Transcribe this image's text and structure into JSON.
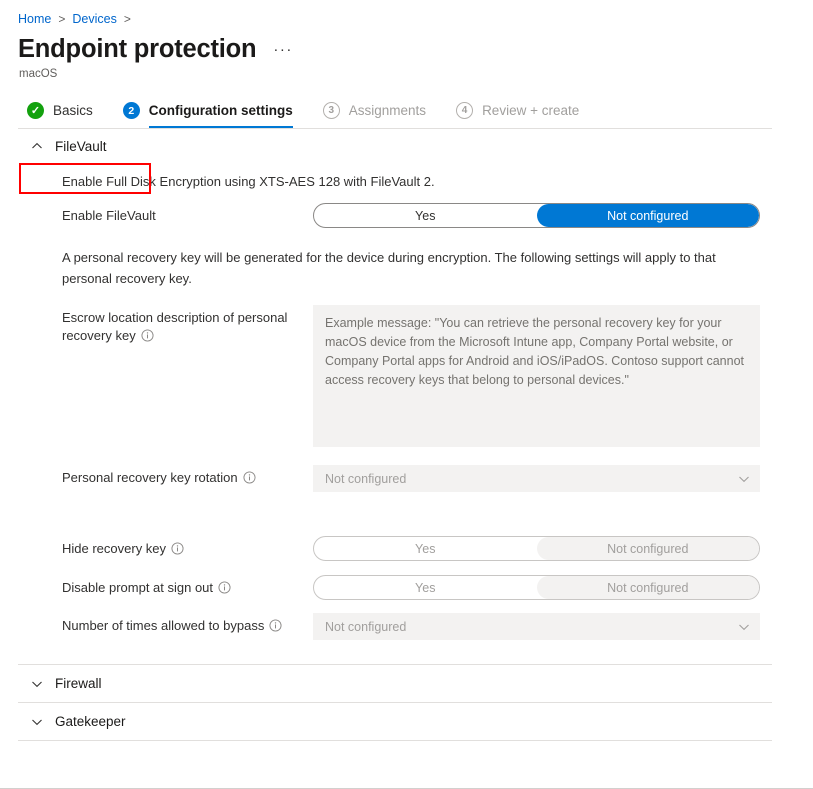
{
  "breadcrumb": {
    "items": [
      "Home",
      "Devices"
    ],
    "separator": ">"
  },
  "header": {
    "title": "Endpoint protection",
    "subtitle": "macOS",
    "more_label": "···"
  },
  "wizard": {
    "tabs": [
      {
        "badge": "✓",
        "label": "Basics",
        "state": "done"
      },
      {
        "badge": "2",
        "label": "Configuration settings",
        "state": "active"
      },
      {
        "badge": "3",
        "label": "Assignments",
        "state": "todo"
      },
      {
        "badge": "4",
        "label": "Review + create",
        "state": "todo"
      }
    ]
  },
  "sections": {
    "filevault": {
      "title": "FileVault",
      "expanded": true,
      "description": "Enable Full Disk Encryption using XTS-AES 128 with FileVault 2.",
      "paragraph": "A personal recovery key will be generated for the device during encryption. The following settings will apply to that personal recovery key.",
      "enable_filevault": {
        "label": "Enable FileVault",
        "options": [
          "Yes",
          "Not configured"
        ],
        "selected": "Not configured"
      },
      "escrow_location": {
        "label": "Escrow location description of personal recovery key",
        "placeholder": "Example message: \"You can retrieve the personal recovery key for your macOS device from the Microsoft Intune app, Company Portal website, or Company Portal apps for Android and iOS/iPadOS. Contoso support cannot access recovery keys that belong to personal devices.\"",
        "value": ""
      },
      "key_rotation": {
        "label": "Personal recovery key rotation",
        "value": "Not configured"
      },
      "hide_recovery_key": {
        "label": "Hide recovery key",
        "options": [
          "Yes",
          "Not configured"
        ],
        "selected": "Not configured"
      },
      "disable_prompt": {
        "label": "Disable prompt at sign out",
        "options": [
          "Yes",
          "Not configured"
        ],
        "selected": "Not configured"
      },
      "bypass_count": {
        "label": "Number of times allowed to bypass",
        "value": "Not configured"
      }
    },
    "firewall": {
      "title": "Firewall",
      "expanded": false
    },
    "gatekeeper": {
      "title": "Gatekeeper",
      "expanded": false
    }
  },
  "colors": {
    "accent": "#0078d4",
    "success": "#13a10e",
    "annotation": "#ff0000",
    "link": "#0066cc",
    "disabled_bg": "#f3f2f1"
  }
}
